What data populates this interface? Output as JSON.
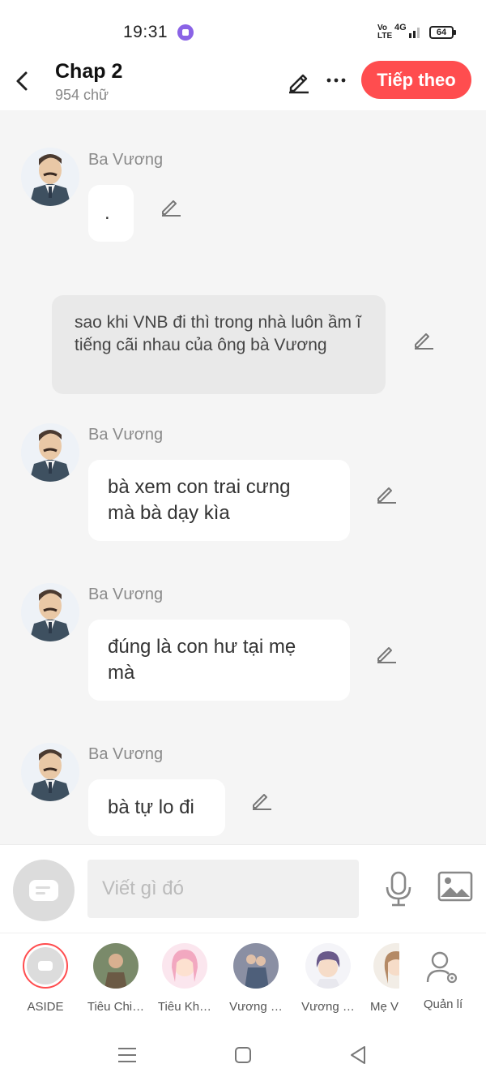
{
  "status_bar": {
    "time": "19:31",
    "network": "4G",
    "volte": "Vo LTE",
    "battery": "64"
  },
  "header": {
    "title": "Chap 2",
    "subtitle": "954 chữ",
    "next_label": "Tiếp theo"
  },
  "messages": [
    {
      "type": "character",
      "sender": "Ba Vương",
      "text": "."
    },
    {
      "type": "narration",
      "text": "sao khi VNB đi thì trong nhà luôn ầm ĩ tiếng cãi nhau của ông bà Vương"
    },
    {
      "type": "character",
      "sender": "Ba Vương",
      "line1": "bà xem con trai cưng",
      "line2": "mà bà dạy kìa"
    },
    {
      "type": "character",
      "sender": "Ba Vương",
      "line1": "đúng là con hư tại mẹ",
      "line2": "mà"
    },
    {
      "type": "character",
      "sender": "Ba Vương",
      "text": "bà tự lo đi"
    }
  ],
  "composer": {
    "placeholder": "Viết gì đó"
  },
  "characters": [
    {
      "label": "ASIDE",
      "kind": "aside"
    },
    {
      "label": "Tiêu Chi…",
      "kind": "photo",
      "color": "#6b5a45"
    },
    {
      "label": "Tiêu Kh…",
      "kind": "anime",
      "color": "#f2a8c0"
    },
    {
      "label": "Vương …",
      "kind": "photo",
      "color": "#4e5f7a"
    },
    {
      "label": "Vương …",
      "kind": "anime",
      "color": "#6a5a8a"
    },
    {
      "label": "Mẹ Vươ",
      "kind": "anime",
      "color": "#b48a66"
    }
  ],
  "manage_label": "Quản lí",
  "colors": {
    "accent": "#ff4d4f",
    "chat_bg": "#f5f5f5",
    "narration_bg": "#e9e9e9"
  }
}
